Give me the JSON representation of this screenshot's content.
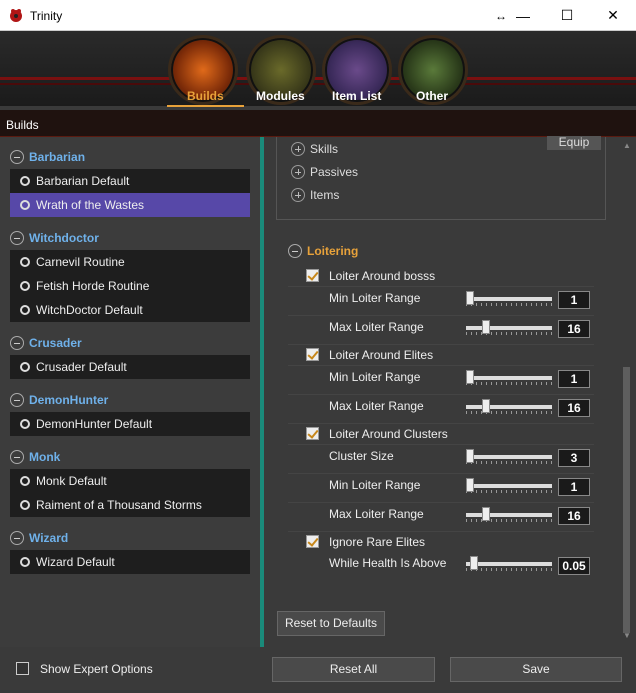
{
  "window": {
    "title": "Trinity",
    "resize_icon": "resize-icon",
    "minimize": "—",
    "maximize": "☐",
    "close": "✕"
  },
  "nav": {
    "tabs": [
      {
        "label": "Builds",
        "active": true
      },
      {
        "label": "Modules"
      },
      {
        "label": "Item List"
      },
      {
        "label": "Other"
      }
    ]
  },
  "section": {
    "title": "Builds"
  },
  "classes": [
    {
      "name": "Barbarian",
      "builds": [
        "Barbarian Default",
        "Wrath of the Wastes"
      ],
      "selected": 1
    },
    {
      "name": "Witchdoctor",
      "builds": [
        "Carnevil Routine",
        "Fetish Horde Routine",
        "WitchDoctor Default"
      ]
    },
    {
      "name": "Crusader",
      "builds": [
        "Crusader Default"
      ]
    },
    {
      "name": "DemonHunter",
      "builds": [
        "DemonHunter Default"
      ]
    },
    {
      "name": "Monk",
      "builds": [
        "Monk Default",
        "Raiment of a Thousand Storms"
      ]
    },
    {
      "name": "Wizard",
      "builds": [
        "Wizard Default"
      ]
    }
  ],
  "right": {
    "equip_label": "Equip",
    "expanders": [
      "Skills",
      "Passives",
      "Items"
    ],
    "loitering_title": "Loitering",
    "loiter_bosses": "Loiter Around bosss",
    "boss_min_label": "Min Loiter Range",
    "boss_min": "1",
    "boss_min_frac": 0.0,
    "boss_max_label": "Max Loiter Range",
    "boss_max": "16",
    "boss_max_frac": 0.2,
    "loiter_elites": "Loiter Around Elites",
    "elite_min_label": "Min Loiter Range",
    "elite_min": "1",
    "elite_min_frac": 0.0,
    "elite_max_label": "Max Loiter Range",
    "elite_max": "16",
    "elite_max_frac": 0.2,
    "loiter_clusters": "Loiter Around Clusters",
    "cluster_size_label": "Cluster Size",
    "cluster_size": "3",
    "cluster_size_frac": 0.0,
    "cluster_min_label": "Min Loiter Range",
    "cluster_min": "1",
    "cluster_min_frac": 0.0,
    "cluster_max_label": "Max Loiter Range",
    "cluster_max": "16",
    "cluster_max_frac": 0.2,
    "ignore_rare": "Ignore Rare Elites",
    "health_label": "While Health Is Above",
    "health": "0.05",
    "health_frac": 0.05,
    "reset_defaults": "Reset to Defaults"
  },
  "bottom": {
    "expert_label": "Show Expert Options",
    "reset_all": "Reset All",
    "save": "Save"
  },
  "colors": {
    "accent": "#e8a23a",
    "class_header": "#6fb1ea",
    "selected": "#5748a8",
    "divider": "#1a8a7a"
  }
}
